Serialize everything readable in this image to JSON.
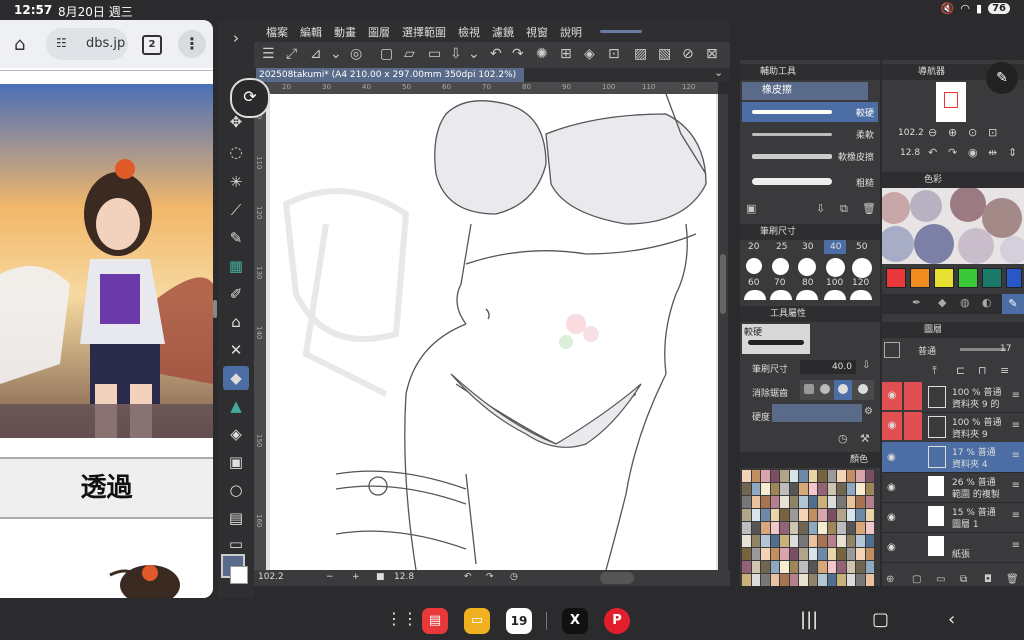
{
  "statusbar": {
    "time": "12:57",
    "date": "8月20日 週三",
    "battery": "76"
  },
  "browser": {
    "url": "dbs.jp",
    "tab_count": "2",
    "transparent_button": "透過"
  },
  "csp": {
    "menu": [
      "檔案",
      "編輯",
      "動畫",
      "圖層",
      "選擇範圍",
      "檢視",
      "濾鏡",
      "視窗",
      "說明"
    ],
    "document_tab": "202508takumi* (A4 210.00 x 297.00mm 350dpi 102.2%)",
    "ruler_top_labels": [
      "20",
      "30",
      "40",
      "50",
      "60",
      "70",
      "80",
      "90",
      "100",
      "110",
      "120"
    ],
    "ruler_left_labels": [
      "100",
      "110",
      "120",
      "130",
      "140",
      "150",
      "160"
    ],
    "zoom": "102.2",
    "rotation": "12.8",
    "sub_tool_panel": {
      "title": "輔助工具",
      "group": "橡皮擦",
      "items": [
        "較硬",
        "柔軟",
        "軟橡皮擦",
        "粗糙"
      ]
    },
    "brush_size_panel": {
      "title": "筆刷尺寸",
      "sizes": [
        "20",
        "25",
        "30",
        "40",
        "50",
        "60",
        "70",
        "80",
        "100",
        "120"
      ]
    },
    "tool_property_panel": {
      "title": "工具屬性",
      "preset": "較硬",
      "brush_size_label": "筆刷尺寸",
      "brush_size_value": "40.0",
      "antialias_label": "消除鋸齒",
      "hardness_label": "硬度"
    },
    "color_set_title": "顏色",
    "navigator": {
      "title": "導航器",
      "zoom": "102.2",
      "rotate": "12.8"
    },
    "color_wheel_title": "色彩",
    "layer_panel": {
      "title": "圖層",
      "blend_mode": "普通",
      "opacity": "17",
      "layers": [
        {
          "percent": "100 %",
          "mode": "普通",
          "name": "資料夾 9 的"
        },
        {
          "percent": "100 %",
          "mode": "普通",
          "name": "資料夾 9"
        },
        {
          "percent": "17 %",
          "mode": "普通",
          "name": "資料夾 4"
        },
        {
          "percent": "26 %",
          "mode": "普通",
          "name": "範圍 的複製"
        },
        {
          "percent": "15 %",
          "mode": "普通",
          "name": "圖層 1"
        },
        {
          "percent": "",
          "mode": "",
          "name": "紙張"
        }
      ]
    },
    "colors": {
      "selected_tool": "#4d6ea5",
      "layer_red": "#e05050",
      "layer_selected": "#4d6ea5"
    }
  },
  "navbar": {
    "calendar_day": "19"
  }
}
